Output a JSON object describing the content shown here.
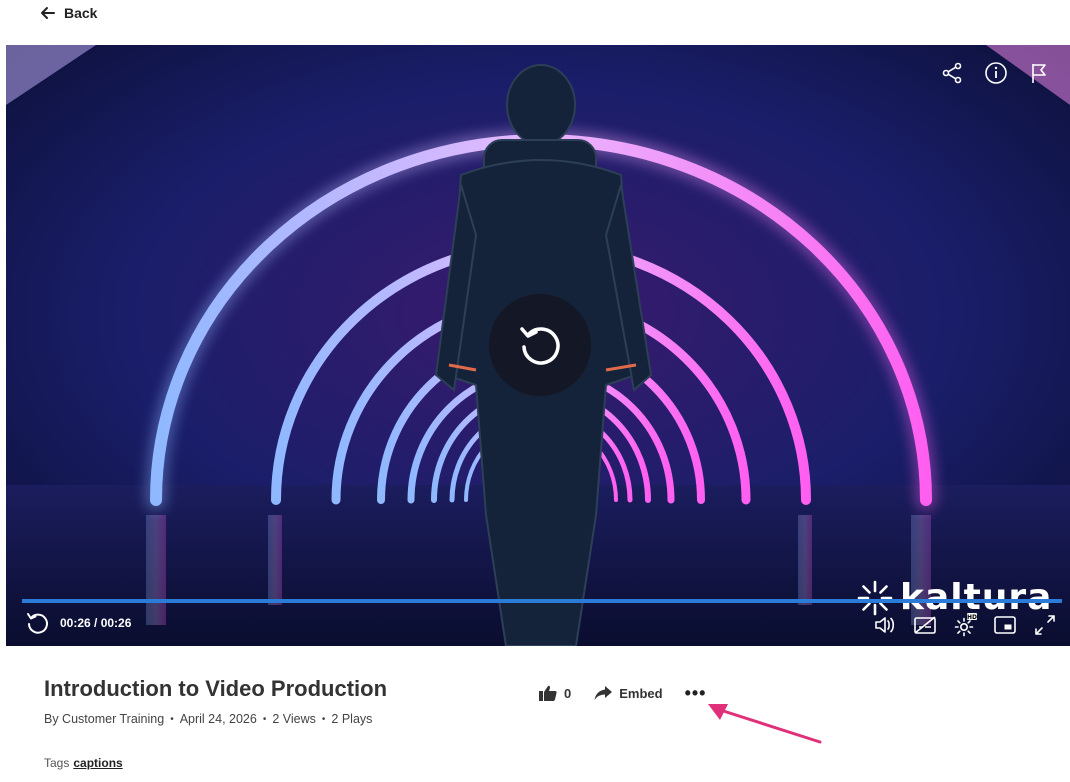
{
  "nav": {
    "back_label": "Back"
  },
  "player": {
    "time_display": "00:26 / 00:26",
    "progress_fraction": 1.0,
    "brand": "kaltura",
    "icons": {
      "share": "share-icon",
      "info": "info-icon",
      "report": "flag-icon",
      "replay": "replay-icon",
      "volume": "volume-icon",
      "captions": "captions-off-icon",
      "settings": "settings-icon",
      "hd_badge": "HD",
      "pip": "picture-in-picture-icon",
      "fullscreen": "fullscreen-icon"
    }
  },
  "media": {
    "title": "Introduction to Video Production",
    "author": "By Customer Training",
    "date": "April 24, 2026",
    "views": "2 Views",
    "plays": "2 Plays"
  },
  "actions": {
    "like_count": "0",
    "embed_label": "Embed",
    "more_label": "•••"
  },
  "tags": {
    "label": "Tags",
    "items": [
      "captions"
    ]
  },
  "colors": {
    "accent": "#2b7bd9",
    "annotation_arrow": "#e0307a"
  }
}
